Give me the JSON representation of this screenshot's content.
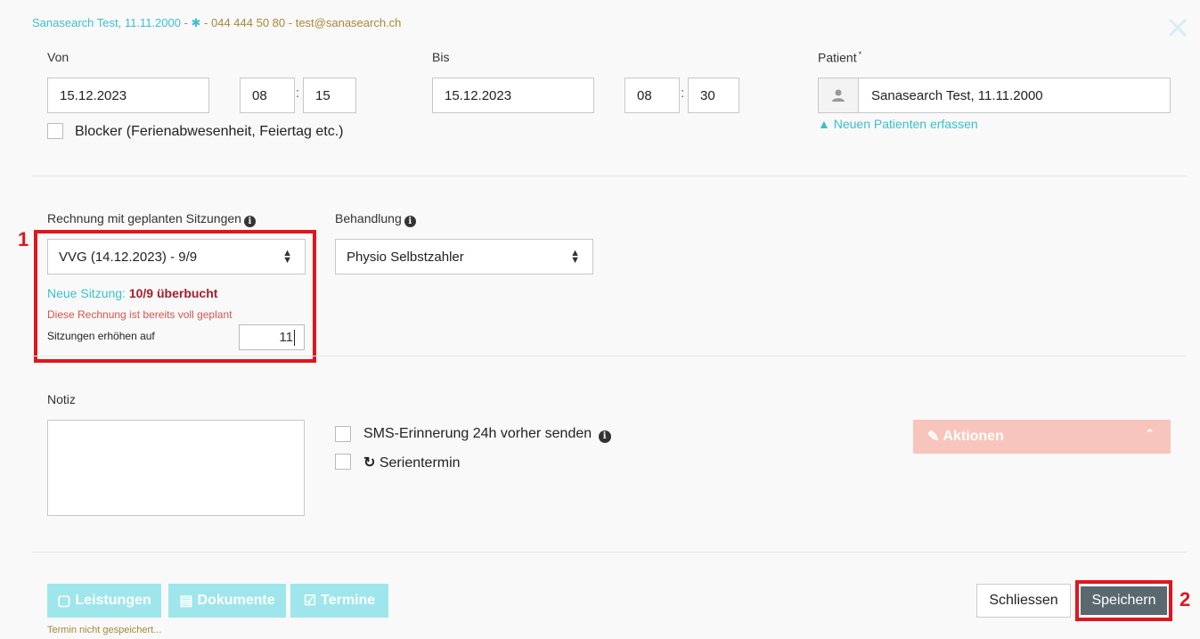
{
  "header": {
    "patient_name_date": "Sanasearch Test, 11.11.2000",
    "sep1": " - ",
    "sep2": " - ",
    "phone": "044 444 50 80",
    "sep3": " - ",
    "email": "test@sanasearch.ch"
  },
  "from": {
    "label": "Von",
    "date": "15.12.2023",
    "hour": "08",
    "minute": "15"
  },
  "to": {
    "label": "Bis",
    "date": "15.12.2023",
    "hour": "08",
    "minute": "30"
  },
  "patient": {
    "label": "Patient",
    "required_mark": "*",
    "value": "Sanasearch Test, 11.11.2000",
    "new_patient_link": "Neuen Patienten erfassen"
  },
  "blocker": {
    "label": "Blocker (Ferienabwesenheit, Feiertag etc.)"
  },
  "invoice": {
    "label": "Rechnung mit geplanten Sitzungen",
    "selected": "VVG (14.12.2023) - 9/9",
    "new_session_prefix": "Neue Sitzung:",
    "new_session_value": "10/9 überbucht",
    "warning": "Diese Rechnung ist bereits voll geplant",
    "increase_label": "Sitzungen erhöhen auf",
    "increase_value": "11"
  },
  "treatment": {
    "label": "Behandlung",
    "selected": "Physio Selbstzahler"
  },
  "note": {
    "label": "Notiz",
    "value": ""
  },
  "sms": {
    "label": "SMS-Erinnerung 24h vorher senden"
  },
  "series": {
    "label": "Serientermin"
  },
  "actions": {
    "label": "Aktionen"
  },
  "footer": {
    "leistungen": "Leistungen",
    "dokumente": "Dokumente",
    "termine": "Termine",
    "status": "Termin nicht gespeichert...",
    "close": "Schliessen",
    "save": "Speichern"
  },
  "annotations": {
    "marker1": "1",
    "marker2": "2"
  },
  "colors": {
    "teal": "#3bbfd0",
    "gold": "#a8873a",
    "highlight_red": "#e0161e",
    "overbooked": "#a31f2a",
    "save_bg": "#5a6870",
    "actions_bg": "#f7c5bc",
    "tab_bg": "#9fe6ec"
  }
}
